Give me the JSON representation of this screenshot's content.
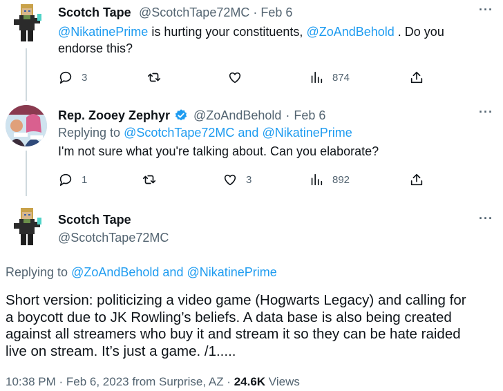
{
  "tweet1": {
    "name": "Scotch Tape",
    "handle": "@ScotchTape72MC",
    "date": "Feb 6",
    "mention1": "@NikatinePrime",
    "text1": " is hurting your constituents, ",
    "mention2": "@ZoAndBehold",
    "text2": " . Do you",
    "text3": "endorse this?",
    "replies": "3",
    "views": "874"
  },
  "tweet2": {
    "name": "Rep. Zooey Zephyr",
    "handle": "@ZoAndBehold",
    "date": "Feb 6",
    "replying_prefix": "Replying to ",
    "replying_to": "@ScotchTape72MC and @NikatinePrime",
    "text": "I'm not sure what you're talking about. Can you elaborate?",
    "replies": "1",
    "likes": "3",
    "views": "892"
  },
  "tweet3": {
    "name": "Scotch Tape",
    "handle": "@ScotchTape72MC",
    "replying_prefix": "Replying to ",
    "replying_to": "@ZoAndBehold and @NikatinePrime",
    "lines": [
      "Short version: politicizing a video game (Hogwarts Legacy) and calling for",
      "a boycott due to JK Rowling’s beliefs. A data base is also being created",
      "against all streamers who buy it and stream it so they can be hate raided",
      "live on stream. It’s just a game. /1....."
    ],
    "time_date": "10:38 PM · Feb 6, 2023 from Surprise, AZ · ",
    "views_count": "24.6K",
    "views_label": " Views"
  },
  "more_label": "···",
  "dot": "·"
}
